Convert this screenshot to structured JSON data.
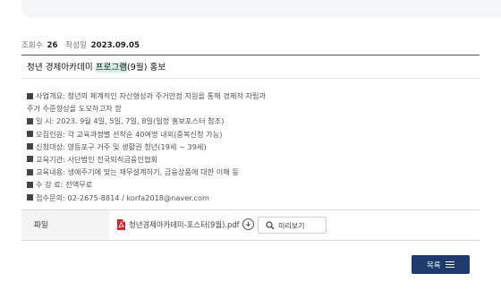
{
  "meta": {
    "views_label": "조회수",
    "views": "26",
    "date_label": "작성일",
    "date": "2023.09.05"
  },
  "post": {
    "title_pre": "청년 경제아카데미 ",
    "title_highlight": "프로그램",
    "title_post": "(9월) 홍보"
  },
  "body_lines": [
    {
      "bullet": true,
      "text": "사업개요: 청년의 체계적인 자산형성과 주거안정 지원을 통해 경제적 자립과"
    },
    {
      "bullet": false,
      "text": "주거 수준향상을 도모하고자 함"
    },
    {
      "bullet": true,
      "text": "일 시: 2023. 9월 4일, 5일, 7일, 8일(일정 홍보포스터 참조)"
    },
    {
      "bullet": true,
      "text": "모집인원: 각 교육과정별 선착순 40여명 내외(중복신청 가능)"
    },
    {
      "bullet": true,
      "text": "신청대상: 영등포구 거주 및 생활권 청년(19세 ~ 39세)"
    },
    {
      "bullet": true,
      "text": "교육기관: 사단법인 전국퇴직금융인협회"
    },
    {
      "bullet": true,
      "text": "교육내용: 생애주기에 맞는 재무설계하기, 금융상품에 대한 이해 등"
    },
    {
      "bullet": true,
      "text": "수 강 료: 전액무료"
    },
    {
      "bullet": true,
      "text": "접수문의: 02-2675-8814 / korfa2018@naver.com"
    }
  ],
  "attachment": {
    "label": "파일",
    "file_name": "청년경제아카데미-포스터(9월).pdf",
    "file_icon": "pdf-icon",
    "download_icon": "download-icon",
    "preview_label": "미리보기",
    "preview_icon": "search-icon"
  },
  "list_button": {
    "label": "목록",
    "icon": "menu-icon"
  },
  "colors": {
    "title_highlight": "#d4ede4",
    "list_button_bg": "#1f3a6d",
    "pdf_red": "#d0262a"
  }
}
